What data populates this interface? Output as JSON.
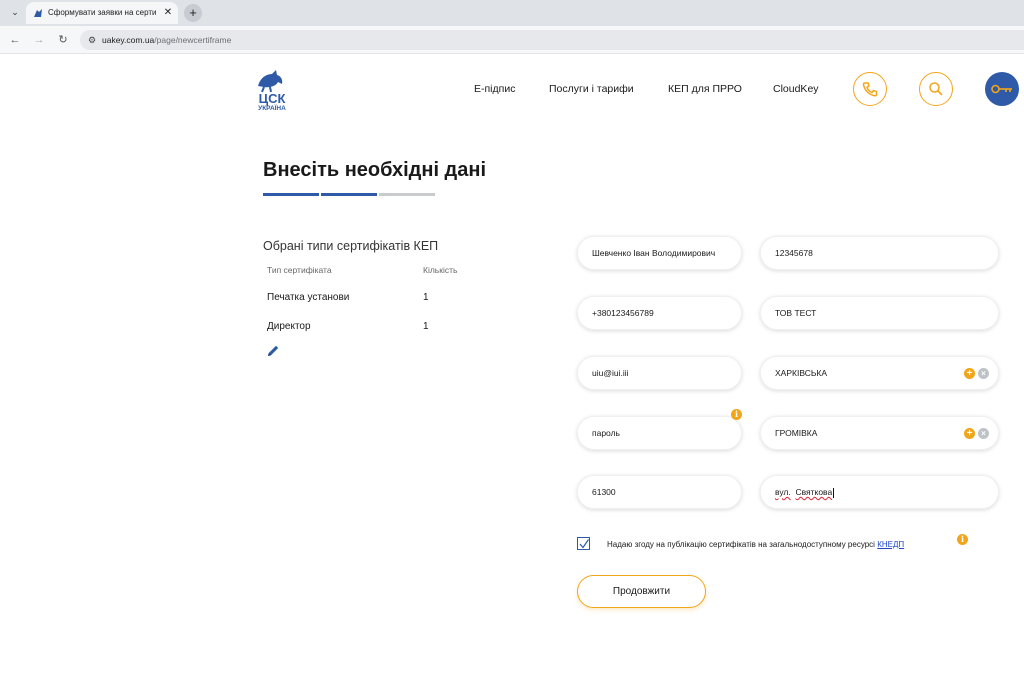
{
  "browser": {
    "tab_title": "Сформувати заявки на сертиф",
    "tab_close": "✕",
    "new_tab": "+",
    "url_host": "uakey.com.ua",
    "url_path": "/page/newcertiframe"
  },
  "logo": {
    "text_top": "ЦСК",
    "text_bottom": "УКРАЇНА"
  },
  "menu": {
    "items": [
      "Е-підпис",
      "Послуги і тарифи",
      "КЕП для ПРРО",
      "CloudKey"
    ]
  },
  "heading": {
    "title": "Внесіть необхідні дані"
  },
  "steps": {
    "total": 3,
    "completed": 2
  },
  "certificates": {
    "heading": "Обрані типи сертифікатів КЕП",
    "columns": [
      "Тип сертифіката",
      "Кількість"
    ],
    "rows": [
      {
        "type": "Печатка установи",
        "qty": "1"
      },
      {
        "type": "Директор",
        "qty": "1"
      }
    ]
  },
  "form": {
    "full_name": "Шевченко Іван Володимирович",
    "edrpou": "12345678",
    "phone": "+380123456789",
    "organization": "ТОВ ТЕСТ",
    "email": "uiu@iui.iii",
    "region": "ХАРКІВСЬКА",
    "password": "пароль",
    "city": "ГРОМІВКА",
    "postcode": "61300",
    "street_prefix": "вул.",
    "street_name": "Святкова"
  },
  "consent": {
    "checked": true,
    "text": "Надаю згоду на публікацію сертифікатів на загальнодоступному ресурсі",
    "link": "КНЕДП"
  },
  "buttons": {
    "continue": "Продовжити"
  },
  "colors": {
    "accent_orange": "#f2a51a",
    "brand_blue": "#2e5aa8",
    "step_inactive": "#c9cbcf"
  }
}
